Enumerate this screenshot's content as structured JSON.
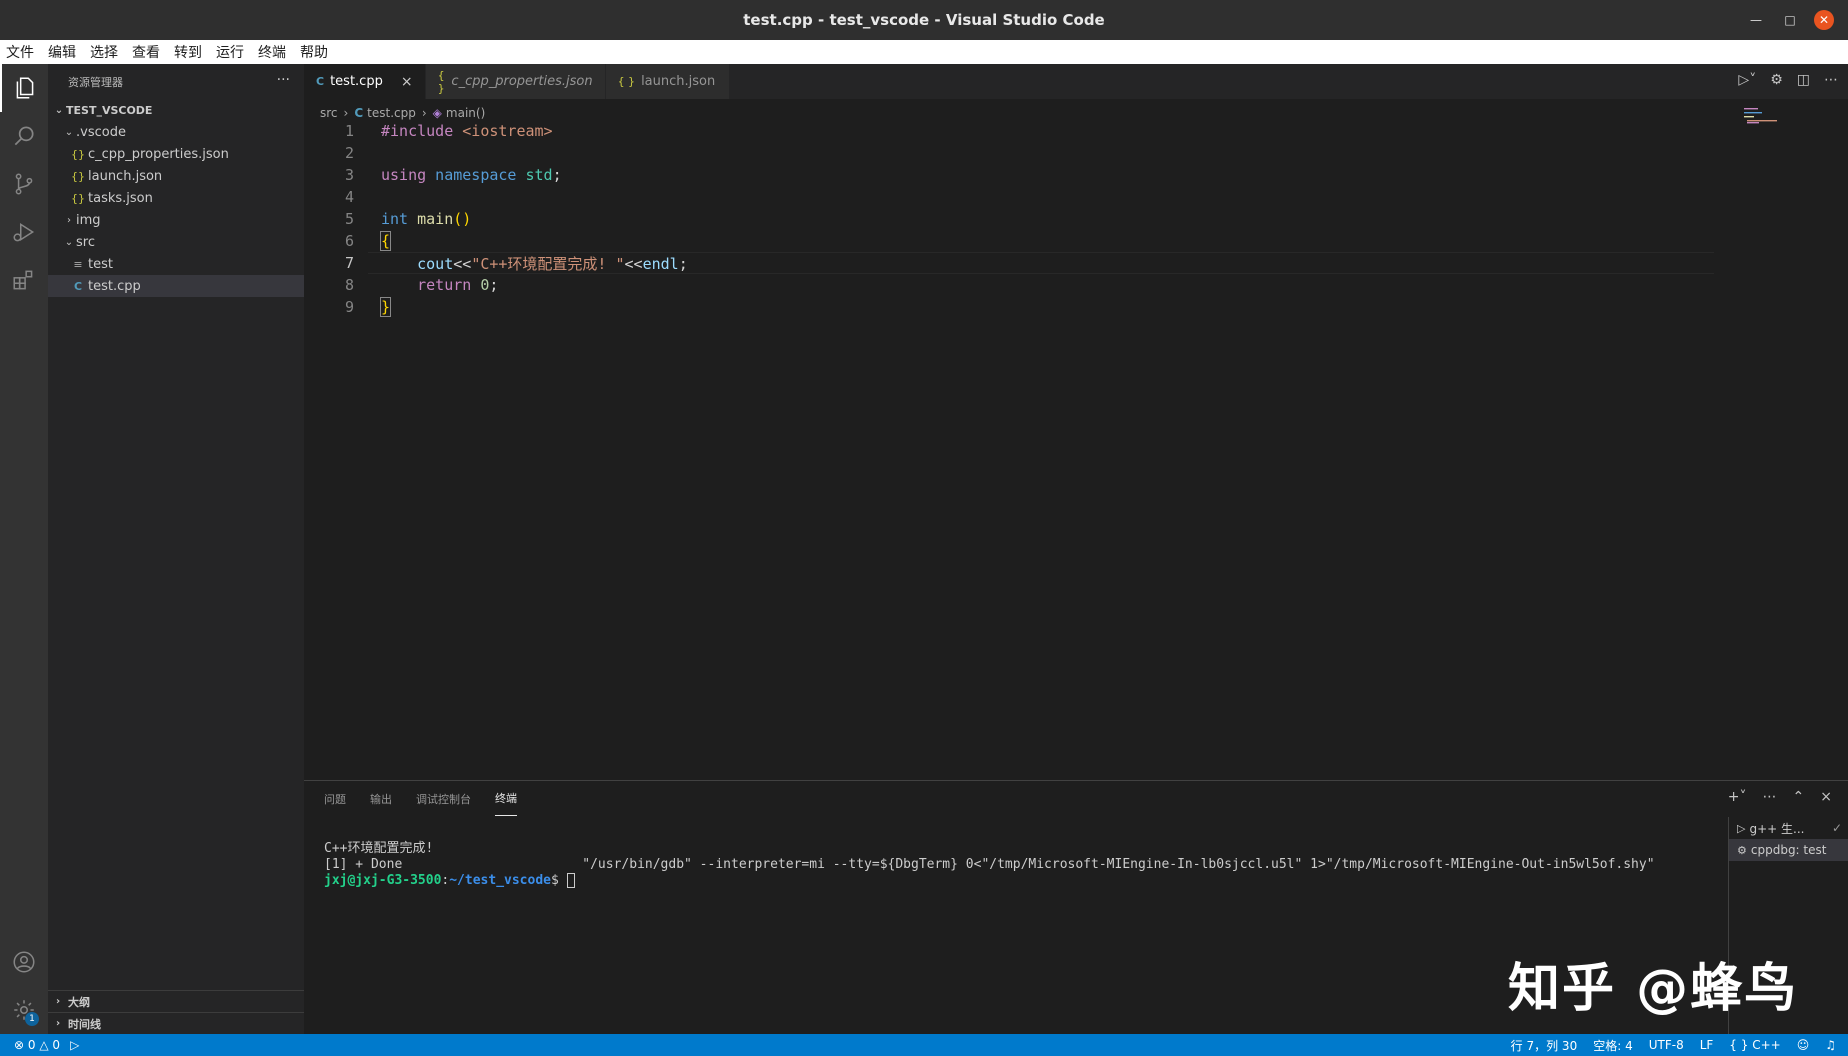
{
  "window": {
    "title": "test.cpp - test_vscode - Visual Studio Code"
  },
  "menu": [
    "文件",
    "编辑",
    "选择",
    "查看",
    "转到",
    "运行",
    "终端",
    "帮助"
  ],
  "sidebar": {
    "header": "资源管理器",
    "more": "···",
    "root": "TEST_VSCODE",
    "tree": [
      {
        "label": ".vscode",
        "type": "folder",
        "expanded": true,
        "depth": 1
      },
      {
        "label": "c_cpp_properties.json",
        "type": "json",
        "depth": 2
      },
      {
        "label": "launch.json",
        "type": "json",
        "depth": 2
      },
      {
        "label": "tasks.json",
        "type": "json",
        "depth": 2
      },
      {
        "label": "img",
        "type": "folder",
        "expanded": false,
        "depth": 1
      },
      {
        "label": "src",
        "type": "folder",
        "expanded": true,
        "depth": 1
      },
      {
        "label": "test",
        "type": "text",
        "depth": 2
      },
      {
        "label": "test.cpp",
        "type": "cpp",
        "depth": 2,
        "selected": true
      }
    ],
    "outline": "大纲",
    "timeline": "时间线"
  },
  "tabs": [
    {
      "label": "test.cpp",
      "icon": "C",
      "active": true
    },
    {
      "label": "c_cpp_properties.json",
      "icon": "{ }",
      "active": false,
      "italic": true
    },
    {
      "label": "launch.json",
      "icon": "{ }",
      "active": false
    }
  ],
  "breadcrumb": {
    "folder": "src",
    "file": "test.cpp",
    "symbol": "main()"
  },
  "code": {
    "line_numbers": [
      "1",
      "2",
      "3",
      "4",
      "5",
      "6",
      "7",
      "8",
      "9"
    ],
    "l1_include": "#include",
    "l1_header": " <iostream>",
    "l3_using": "using",
    "l3_namespace": " namespace",
    "l3_std": " std",
    "l3_semi": ";",
    "l5_int": "int",
    "l5_main": " main",
    "l5_parens": "()",
    "l6_brace": "{",
    "l7_cout": "    cout",
    "l7_op": "<<",
    "l7_str": "\"C++环境配置完成! \"",
    "l7_op2": "<<",
    "l7_endl": "endl",
    "l7_semi": ";",
    "l8_return": "    return",
    "l8_zero": " 0",
    "l8_semi": ";",
    "l9_brace": "}"
  },
  "panel": {
    "tabs": [
      "问题",
      "输出",
      "调试控制台",
      "终端"
    ],
    "active_tab": "终端",
    "terminal": {
      "line1": "C++环境配置完成!",
      "line2": "[1] + Done                       \"/usr/bin/gdb\" --interpreter=mi --tty=${DbgTerm} 0<\"/tmp/Microsoft-MIEngine-In-lb0sjccl.u5l\" 1>\"/tmp/Microsoft-MIEngine-Out-in5wl5of.shy\"",
      "prompt_user": "jxj@jxj-G3-3500",
      "prompt_sep": ":",
      "prompt_path": "~/test_vscode",
      "prompt_end": "$ "
    },
    "terminal_list": [
      {
        "label": "g++ 生...",
        "icon": "terminal-icon",
        "check": "✓"
      },
      {
        "label": "cppdbg: test",
        "icon": "debug-icon",
        "selected": true
      }
    ]
  },
  "watermark": "知乎 @蜂鸟",
  "status": {
    "errors": "0",
    "warnings": "0",
    "position": "行 7，列 30",
    "spaces": "空格: 4",
    "encoding": "UTF-8",
    "eol": "LF",
    "language": "C++"
  },
  "colors": {
    "accent": "#007acc",
    "close": "#e95420"
  }
}
